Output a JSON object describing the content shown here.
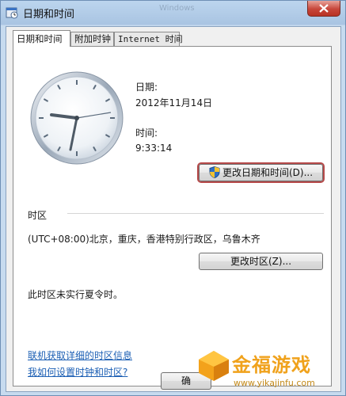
{
  "window": {
    "title": "日期和时间",
    "ghost_title": "Windows"
  },
  "tabs": [
    {
      "label": "日期和时间",
      "active": true
    },
    {
      "label": "附加时钟",
      "active": false
    },
    {
      "label": "Internet 时间",
      "active": false
    }
  ],
  "date": {
    "label": "日期:",
    "value": "2012年11月14日"
  },
  "time": {
    "label": "时间:",
    "value": "9:33:14"
  },
  "change_datetime_button": "更改日期和时间(D)...",
  "timezone": {
    "section_label": "时区",
    "value": "(UTC+08:00)北京，重庆，香港特别行政区，乌鲁木齐",
    "change_button": "更改时区(Z)...",
    "dst_note": "此时区未实行夏令时。"
  },
  "links": {
    "online_info": "联机获取详细的时区信息",
    "how_to": "我如何设置时钟和时区?"
  },
  "ok_button": "确",
  "watermark": {
    "text": "金福游戏",
    "url": "www.yikajinfu.com"
  },
  "colors": {
    "accent_link": "#1c5fb4",
    "watermark": "#f0a21c",
    "close_button": "#c7463a"
  }
}
